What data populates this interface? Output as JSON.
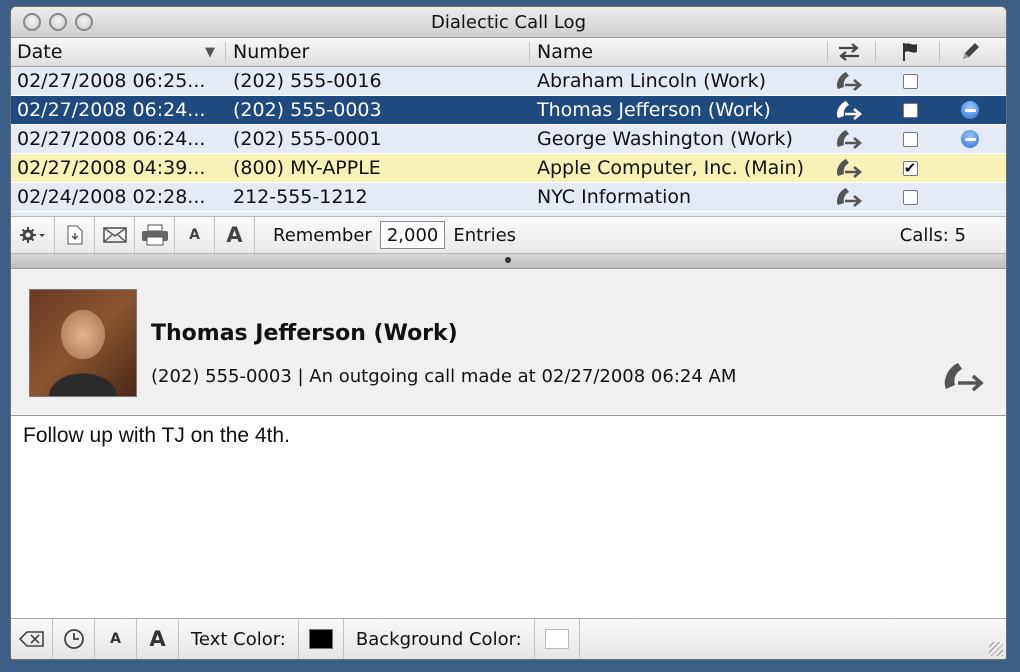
{
  "window": {
    "title": "Dialectic Call Log"
  },
  "columns": {
    "date": "Date",
    "number": "Number",
    "name": "Name"
  },
  "calls": [
    {
      "date": "02/27/2008 06:25...",
      "number": "(202) 555-0016",
      "name": "Abraham Lincoln (Work)",
      "direction": "outgoing",
      "flagged": false,
      "has_note": false,
      "selected": false,
      "highlighted": false
    },
    {
      "date": "02/27/2008 06:24...",
      "number": "(202) 555-0003",
      "name": "Thomas Jefferson (Work)",
      "direction": "outgoing",
      "flagged": false,
      "has_note": true,
      "selected": true,
      "highlighted": false
    },
    {
      "date": "02/27/2008 06:24...",
      "number": "(202) 555-0001",
      "name": "George Washington (Work)",
      "direction": "outgoing",
      "flagged": false,
      "has_note": true,
      "selected": false,
      "highlighted": false
    },
    {
      "date": "02/27/2008 04:39...",
      "number": "(800) MY-APPLE",
      "name": "Apple Computer, Inc. (Main)",
      "direction": "outgoing",
      "flagged": true,
      "has_note": false,
      "selected": false,
      "highlighted": true
    },
    {
      "date": "02/24/2008 02:28...",
      "number": "212-555-1212",
      "name": "NYC Information",
      "direction": "outgoing",
      "flagged": false,
      "has_note": false,
      "selected": false,
      "highlighted": false
    }
  ],
  "toolbar": {
    "remember_label": "Remember",
    "remember_value": "2,000",
    "entries_label": "Entries",
    "calls_count": "Calls: 5",
    "font_small": "A",
    "font_large": "A"
  },
  "detail": {
    "name": "Thomas Jefferson (Work)",
    "info": "(202) 555-0003 | An outgoing call made at 02/27/2008 06:24 AM"
  },
  "notes": {
    "text": "Follow up with TJ on the 4th."
  },
  "format_bar": {
    "font_small": "A",
    "font_large": "A",
    "text_color_label": "Text Color:",
    "text_color": "#000000",
    "background_color_label": "Background Color:",
    "background_color": "#ffffff"
  },
  "colors": {
    "selection": "#1f4a7d",
    "highlight": "#f7f3b8",
    "note_dot": "#2a6fd6"
  }
}
